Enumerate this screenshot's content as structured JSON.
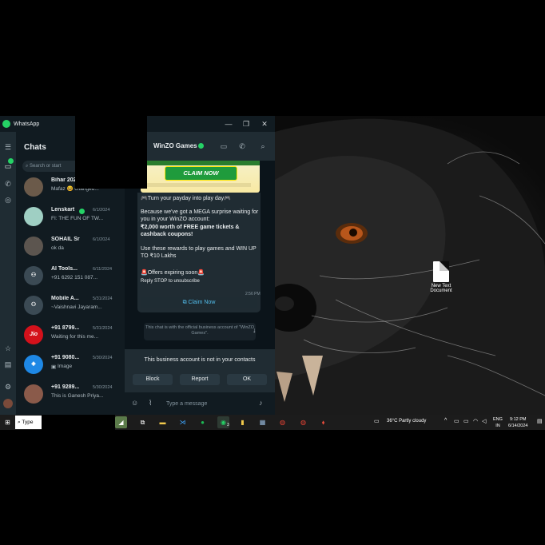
{
  "whatsapp": {
    "app_title": "WhatsApp",
    "chats_header": "Chats",
    "search_placeholder": "Search or start",
    "chats": [
      {
        "name": "Bihar 202...",
        "date": "",
        "preview": "Mafaz 😆 changed...",
        "avatar": ""
      },
      {
        "name": "Lenskart",
        "date": "6/1/2024",
        "preview": "FI: THE FUN OF TW...",
        "avatar": ""
      },
      {
        "name": "SOHAIL Sr",
        "date": "6/1/2024",
        "preview": "ok da",
        "avatar": ""
      },
      {
        "name": "AI Tools...",
        "date": "6/11/2024",
        "preview": "+91 6292 151 087...",
        "avatar": ""
      },
      {
        "name": "Mobile A...",
        "date": "5/31/2024",
        "preview": "~Vaishnavi Jayaram...",
        "avatar": ""
      },
      {
        "name": "+91 8799...",
        "date": "5/31/2024",
        "preview": "Waiting for this me...",
        "avatar": "Jio"
      },
      {
        "name": "+91 9080...",
        "date": "5/30/2024",
        "preview": "Image",
        "avatar": ""
      },
      {
        "name": "+91 9289...",
        "date": "5/30/2024",
        "preview": "This is Ganesh Priya...",
        "avatar": ""
      }
    ],
    "active_chat": {
      "name": "WinZO Games",
      "banner_cta": "CLAIM NOW",
      "message": {
        "line1": "🎮Turn your payday into play day🎮",
        "para1": "Because we've got a MEGA surprise waiting for you in your WinZO account:",
        "para1_bold": "₹2,000 worth of FREE game tickets & cashback coupons!",
        "para2": "Use these rewards to play games and WIN UP TO ₹10 Lakhs",
        "offer": "🚨Offers expiring soon🚨",
        "stop": "Reply STOP to unsubscribe",
        "time": "2:56 PM",
        "button": "Claim Now"
      },
      "notice": "This chat is with the official business account of \"WinZO Games\".",
      "business_notice": "This business account is not in your contacts",
      "actions": [
        "Block",
        "Report",
        "OK"
      ],
      "composer_placeholder": "Type a message"
    }
  },
  "desktop": {
    "icon_label": "New Text Document"
  },
  "taskbar": {
    "search_text": "Type",
    "weather": "36°C  Partly cloudy",
    "lang_line1": "ENG",
    "lang_line2": "IN",
    "time": "9:12 PM",
    "date": "6/14/2024",
    "whatsapp_badge": "3"
  },
  "colors": {
    "wa_bg": "#111b21",
    "wa_panel": "#202c33",
    "wa_green": "#25d366",
    "link_blue": "#53bdeb"
  }
}
